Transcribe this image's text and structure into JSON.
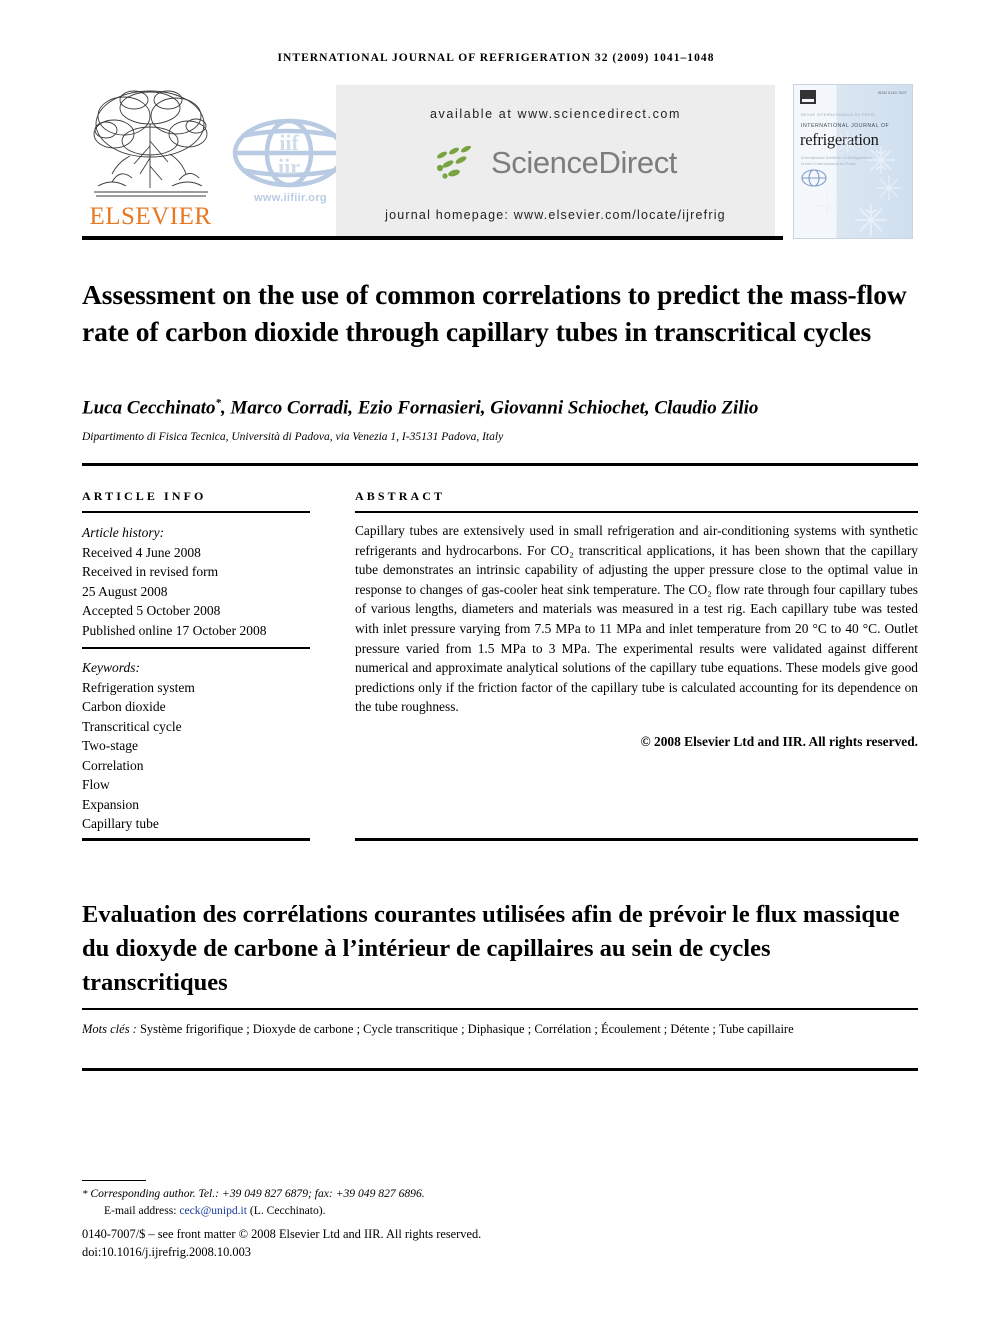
{
  "running_head": "International Journal of Refrigeration 32 (2009) 1041–1048",
  "masthead": {
    "elsevier_wordmark": "ELSEVIER",
    "elsevier_color": "#E87722",
    "iif_url": "www.iifiir.org",
    "iif_color": "#b9cbe3",
    "available_at": "available at www.sciencedirect.com",
    "sciencedirect_wordmark": "ScienceDirect",
    "sciencedirect_color": "#7d7d7d",
    "sciencedirect_leaf_color": "#79a341",
    "journal_homepage": "journal homepage: www.elsevier.com/locate/ijrefrig",
    "box_background": "#ededed"
  },
  "cover": {
    "issn": "ISSN 0140-7007",
    "faint_line_top": "REVUE INTERNATIONALE DU FROID",
    "supertitle": "INTERNATIONAL JOURNAL OF",
    "title": "refrigeration",
    "faint_lines": "International Institute of Refrigeration\nInstitut International du Froid"
  },
  "title": "Assessment on the use of common correlations to predict the mass-flow rate of carbon dioxide through capillary tubes in transcritical cycles",
  "authors": "Luca Cecchinato",
  "authors_rest": ", Marco Corradi, Ezio Fornasieri, Giovanni Schiochet, Claudio Zilio",
  "author_marker": "*",
  "affiliation": "Dipartimento di Fisica Tecnica, Università di Padova, via Venezia 1, I-35131 Padova, Italy",
  "article_info": {
    "heading": "ARTICLE INFO",
    "history_label": "Article history:",
    "history": [
      "Received 4 June 2008",
      "Received in revised form",
      "25 August 2008",
      "Accepted 5 October 2008",
      "Published online 17 October 2008"
    ],
    "keywords_label": "Keywords:",
    "keywords": [
      "Refrigeration system",
      "Carbon dioxide",
      "Transcritical cycle",
      "Two-stage",
      "Correlation",
      "Flow",
      "Expansion",
      "Capillary tube"
    ]
  },
  "abstract": {
    "heading": "ABSTRACT",
    "body": "Capillary tubes are extensively used in small refrigeration and air-conditioning systems with synthetic refrigerants and hydrocarbons. For CO₂ transcritical applications, it has been shown that the capillary tube demonstrates an intrinsic capability of adjusting the upper pressure close to the optimal value in response to changes of gas-cooler heat sink temperature. The CO₂ flow rate through four capillary tubes of various lengths, diameters and materials was measured in a test rig. Each capillary tube was tested with inlet pressure varying from 7.5 MPa to 11 MPa and inlet temperature from 20 °C to 40 °C. Outlet pressure varied from 1.5 MPa to 3 MPa. The experimental results were validated against different numerical and approximate analytical solutions of the capillary tube equations. These models give good predictions only if the friction factor of the capillary tube is calculated accounting for its dependence on the tube roughness.",
    "copyright": "© 2008 Elsevier Ltd and IIR. All rights reserved."
  },
  "french": {
    "title": "Evaluation des corrélations courantes utilisées afin de prévoir le flux massique du dioxyde de carbone à l’intérieur de capillaires au sein de cycles transcritiques",
    "keywords_label": "Mots clés : ",
    "keywords": "Système frigorifique ; Dioxyde de carbone ; Cycle transcritique ; Diphasique ; Corrélation ; Écoulement ; Détente ; Tube capillaire"
  },
  "footer": {
    "corresponding_marker": "*",
    "corresponding_author": "Corresponding author. Tel.: +39 049 827 6879; fax: +39 049 827 6896.",
    "email_label": "E-mail address: ",
    "email": "ceck@unipd.it",
    "email_suffix": " (L. Cecchinato).",
    "email_color": "#1a3b9e",
    "front_matter": "0140-7007/$ – see front matter © 2008 Elsevier Ltd and IIR. All rights reserved.",
    "doi": "doi:10.1016/j.ijrefrig.2008.10.003"
  }
}
